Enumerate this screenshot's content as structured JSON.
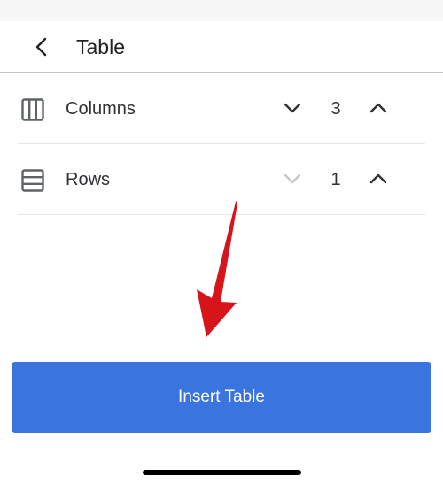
{
  "header": {
    "title": "Table"
  },
  "rows": [
    {
      "label": "Columns",
      "value": "3",
      "icon": "columns-icon",
      "decrement_enabled": true
    },
    {
      "label": "Rows",
      "value": "1",
      "icon": "rows-icon",
      "decrement_enabled": false
    }
  ],
  "insert_button": {
    "label": "Insert Table"
  },
  "colors": {
    "accent": "#3a74df",
    "annotation_arrow": "#d7141a",
    "icon": "#5f6368",
    "disabled": "#c4c7c5"
  }
}
